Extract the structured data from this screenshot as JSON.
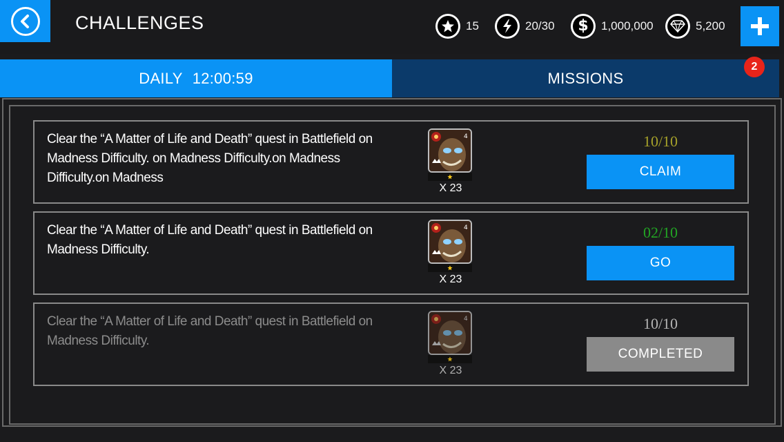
{
  "header": {
    "title": "CHALLENGES",
    "back_icon": "chevron-left-circle-icon",
    "currencies": [
      {
        "name": "stars",
        "icon": "star-icon",
        "value": "15"
      },
      {
        "name": "energy",
        "icon": "lightning-icon",
        "value": "20/30"
      },
      {
        "name": "coins",
        "icon": "dollar-icon",
        "value": "1,000,000"
      },
      {
        "name": "gems",
        "icon": "diamond-icon",
        "value": "5,200"
      }
    ],
    "add_icon": "plus-icon"
  },
  "tabs": {
    "daily": {
      "label": "DAILY",
      "timer": "12:00:59",
      "active": true
    },
    "missions": {
      "label": "MISSIONS",
      "badge": "2",
      "active": false
    }
  },
  "challenges": [
    {
      "description": "Clear the “A Matter of Life and Death” quest in Battlefield on Madness Difficulty. on Madness Difficulty.on Madness Difficulty.on Madness",
      "reward_qty": "X 23",
      "progress": "10/10",
      "progress_color": "#a6a22a",
      "button_label": "CLAIM",
      "state": "claim"
    },
    {
      "description": "Clear the “A Matter of Life and Death” quest in Battlefield on Madness Difficulty.",
      "reward_qty": "X 23",
      "progress": "02/10",
      "progress_color": "#22a524",
      "button_label": "GO",
      "state": "go"
    },
    {
      "description": "Clear the “A Matter of Life and Death” quest in Battlefield on Madness Difficulty.",
      "reward_qty": "X 23",
      "progress": "10/10",
      "progress_color": "#b5b5b5",
      "button_label": "COMPLETED",
      "state": "completed"
    }
  ],
  "colors": {
    "accent": "#0a93f5",
    "tab_inactive": "#0b3a6a",
    "badge": "#e8241a",
    "completed_button": "#8a8a8a"
  }
}
